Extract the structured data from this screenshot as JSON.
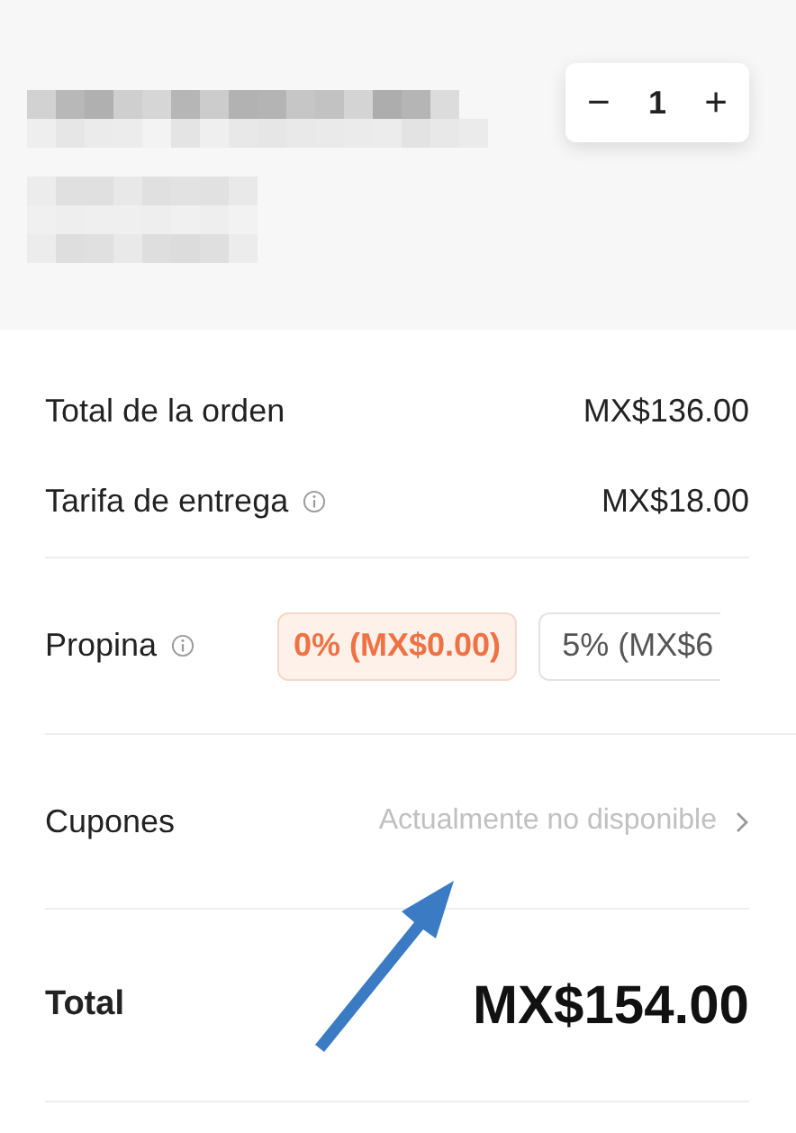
{
  "item": {
    "quantity": "1",
    "quantity_controls": {
      "decrease": "−",
      "increase": "+"
    }
  },
  "summary": [
    {
      "label": "Total de la orden",
      "value": "MX$136.00",
      "info": false
    },
    {
      "label": "Tarifa de entrega",
      "value": "MX$18.00",
      "info": true
    }
  ],
  "tip": {
    "label": "Propina",
    "info": true,
    "options": [
      {
        "label": "0% (MX$0.00)",
        "selected": true
      },
      {
        "label": "5% (MX$6",
        "selected": false
      }
    ]
  },
  "coupons": {
    "label": "Cupones",
    "value": "Actualmente no disponible",
    "disabled": true
  },
  "total": {
    "label": "Total",
    "value": "MX$154.00"
  }
}
